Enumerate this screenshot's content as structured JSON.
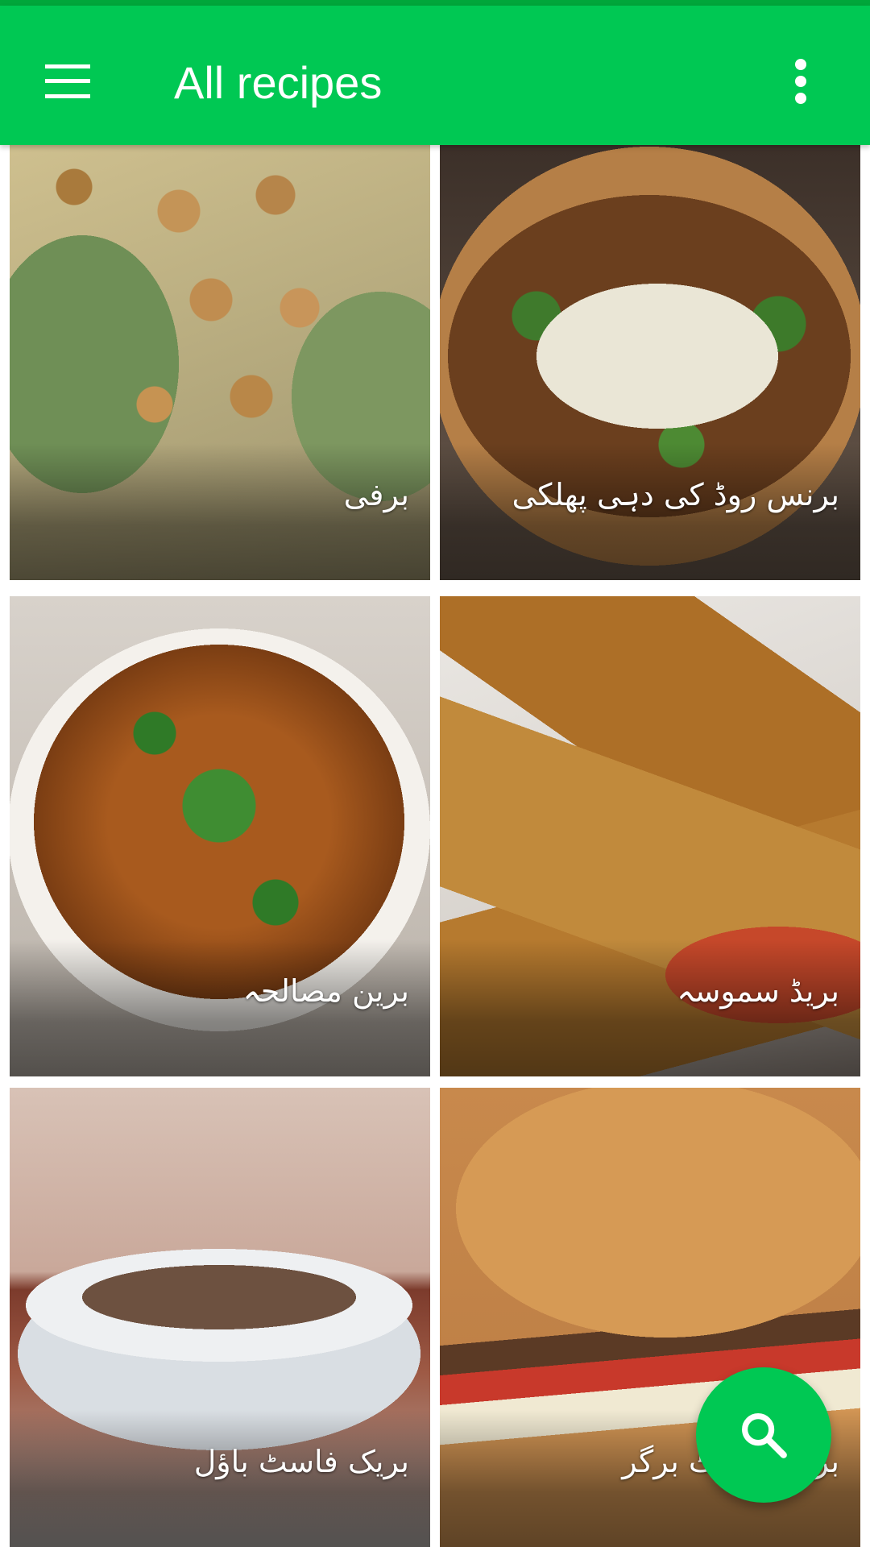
{
  "app_bar": {
    "title": "All recipes",
    "color": "#00c853",
    "menu_icon": "hamburger-menu-icon",
    "overflow_icon": "more-vertical-icon"
  },
  "recipes": [
    {
      "name": "برفی"
    },
    {
      "name": "برنس روڈ کی دہی پھلکی"
    },
    {
      "name": "برین مصالحہ"
    },
    {
      "name": "بریڈ سموسہ"
    },
    {
      "name": "بریک فاسٹ باؤل"
    },
    {
      "name": "بریک فاسٹ برگر"
    }
  ],
  "fab": {
    "icon": "search-icon",
    "color": "#00c853"
  }
}
